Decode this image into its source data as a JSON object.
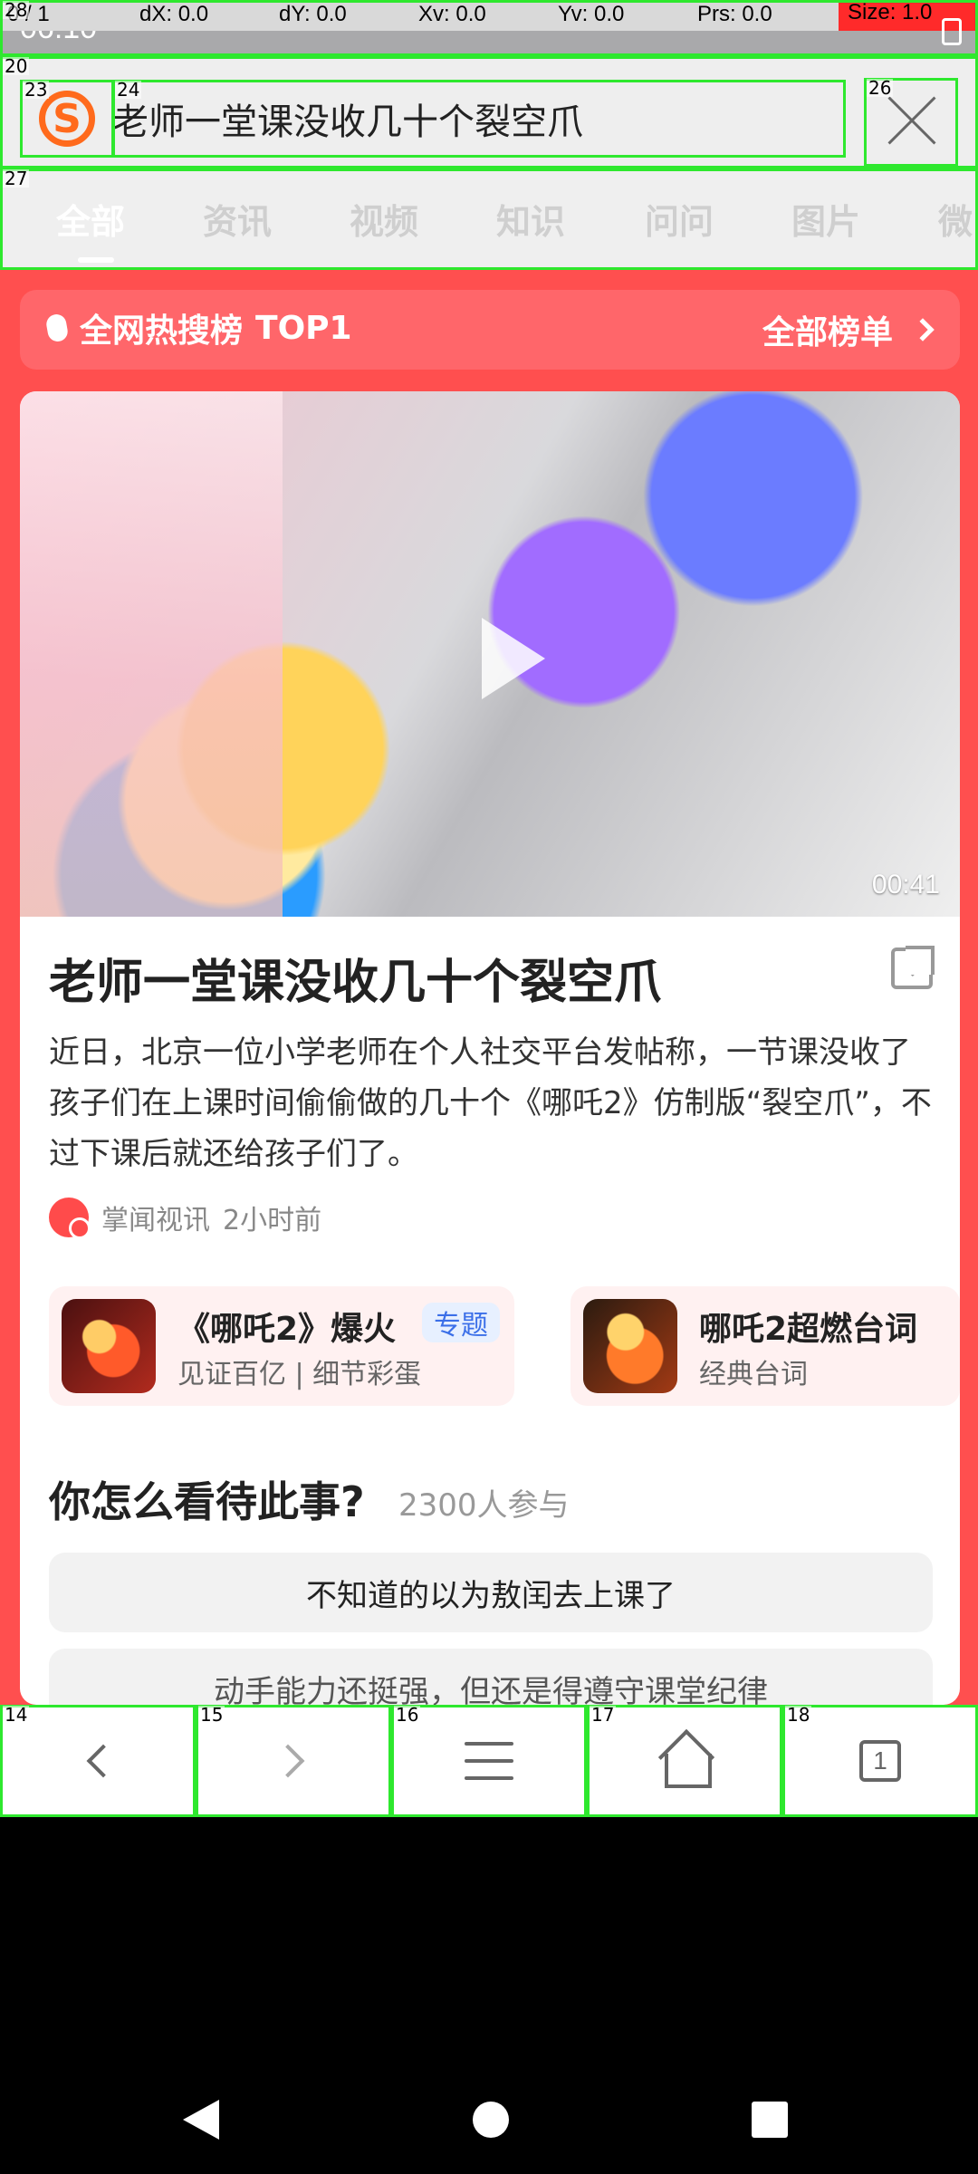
{
  "overlay": {
    "pointer": {
      "pos": "0 / 1",
      "dx": "dX: 0.0",
      "dy": "dY: 0.0",
      "xv": "Xv: 0.0",
      "yv": "Yv: 0.0",
      "prs": "Prs: 0.0",
      "size": "Size: 1.0"
    },
    "box_numbers": {
      "status": "28",
      "topbar": "20",
      "logo": "23",
      "title": "24",
      "close": "26",
      "tabs": "27",
      "back": "14",
      "forward": "15",
      "menu": "16",
      "home": "17",
      "tabs_btn": "18"
    }
  },
  "statusbar": {
    "time": "06:10"
  },
  "topbar": {
    "title": "老师一堂课没收几十个裂空爪"
  },
  "tabs": {
    "items": [
      "全部",
      "资讯",
      "视频",
      "知识",
      "问问",
      "图片",
      "微"
    ],
    "active_index": 0
  },
  "hot": {
    "left": "全网热搜榜",
    "rank": "TOP1",
    "right": "全部榜单"
  },
  "card": {
    "duration": "00:41",
    "title": "老师一堂课没收几十个裂空爪",
    "description": "近日，北京一位小学老师在个人社交平台发帖称，一节课没收了孩子们在上课时间偷偷做的几十个《哪吒2》仿制版“裂空爪”，不过下课后就还给孩子们了。",
    "source": "掌闻视讯",
    "time": "2小时前",
    "topics": [
      {
        "title": "《哪吒2》爆火",
        "sub": "见证百亿 | 细节彩蛋",
        "badge": "专题"
      },
      {
        "title": "哪吒2超燃台词",
        "sub": "经典台词"
      }
    ],
    "poll": {
      "title": "你怎么看待此事?",
      "count": "2300人参与",
      "options": [
        "不知道的以为敖闰去上课了",
        "动手能力还挺强，但还是得遵守课堂纪律"
      ]
    }
  },
  "bottombar": {
    "tabs_count": "1"
  }
}
